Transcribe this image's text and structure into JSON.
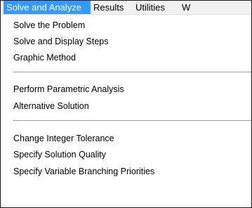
{
  "menubar": {
    "items": [
      {
        "label": "Solve and Analyze",
        "active": true
      },
      {
        "label": "Results"
      },
      {
        "label": "Utilities"
      },
      {
        "label": "W"
      }
    ]
  },
  "dropdown": {
    "groups": [
      [
        "Solve the Problem",
        "Solve and Display Steps",
        "Graphic Method"
      ],
      [
        "Perform Parametric Analysis",
        "Alternative Solution"
      ],
      [
        "Change Integer Tolerance",
        "Specify Solution Quality",
        "Specify Variable Branching Priorities"
      ]
    ]
  },
  "colors": {
    "highlight": "#3399ff",
    "menubar_bg": "#f0f0f0",
    "separator": "#a0a0a0"
  }
}
